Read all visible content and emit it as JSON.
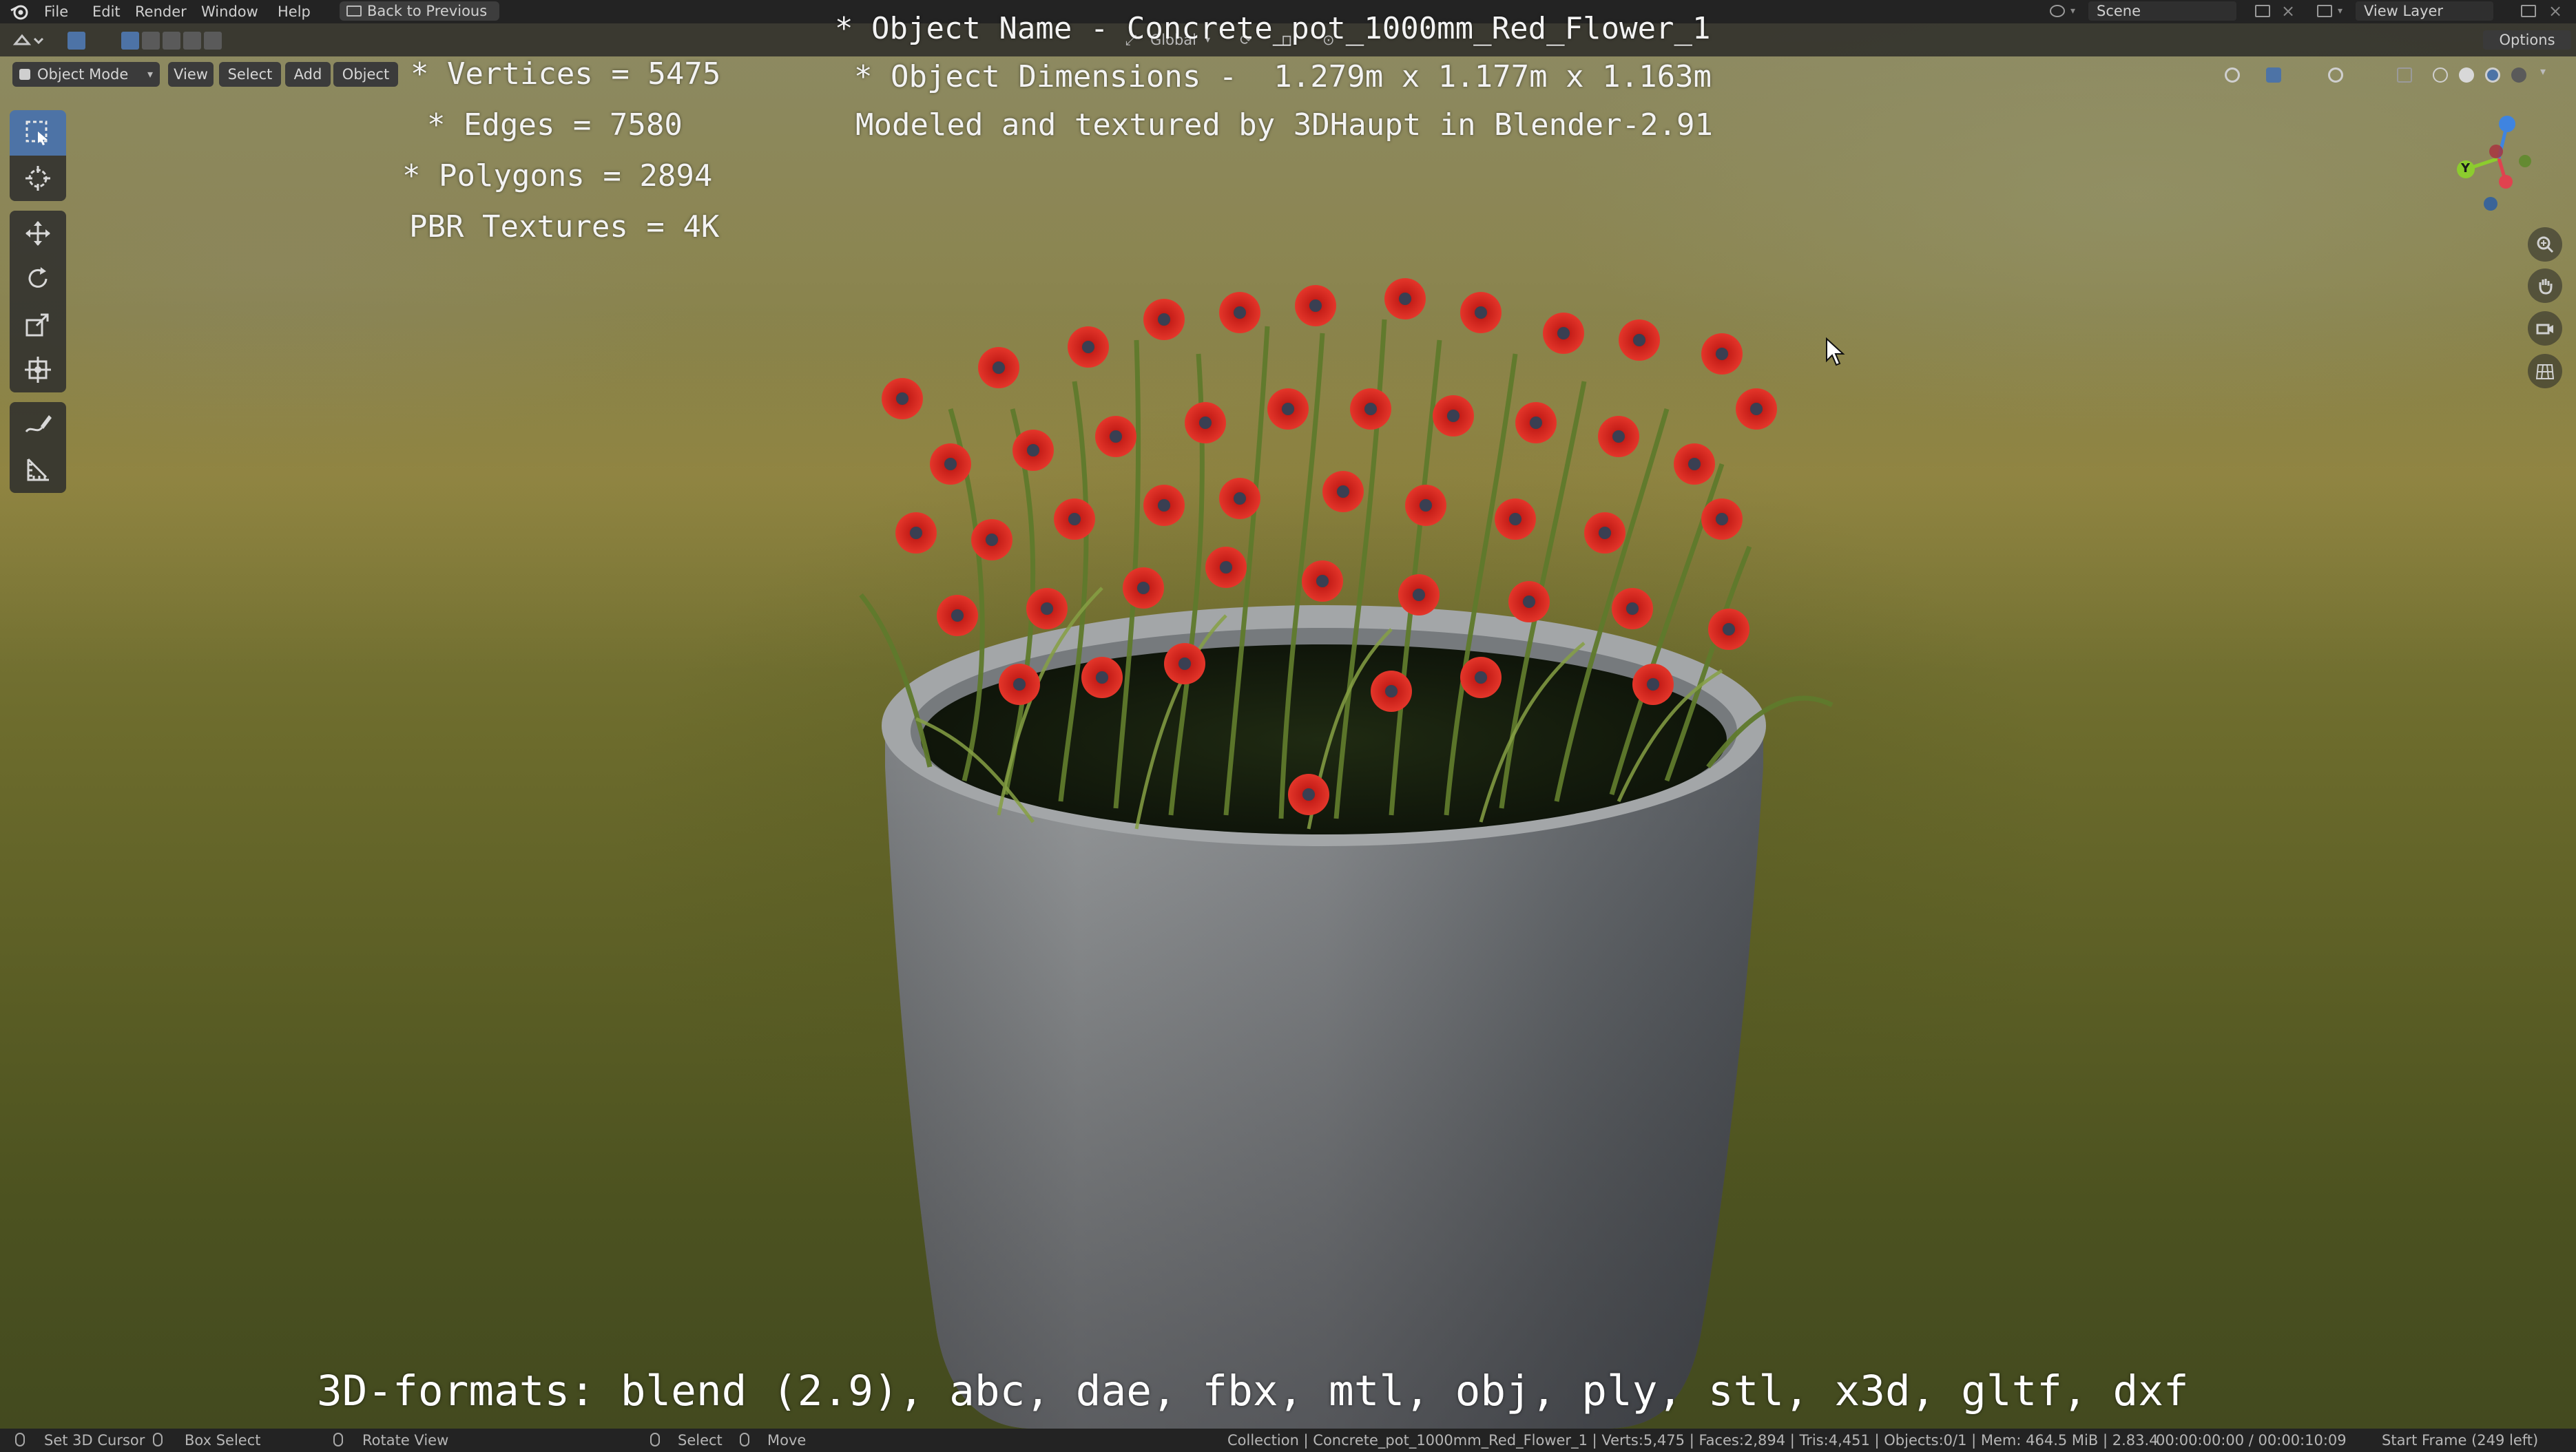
{
  "menubar": {
    "items": [
      "File",
      "Edit",
      "Render",
      "Window",
      "Help"
    ],
    "back_button": "Back to Previous",
    "scene": "Scene",
    "view_layer": "View Layer"
  },
  "viewport_header": {
    "mode": "Object Mode",
    "menus": [
      "View",
      "Select",
      "Add",
      "Object"
    ],
    "transform_orientation": "Global",
    "options": "Options"
  },
  "overlay": {
    "stats_left": [
      "* Vertices = 5475",
      "* Edges = 7580",
      "* Polygons = 2894",
      "PBR Textures = 4K"
    ],
    "info_top": [
      "* Object Name - Concrete_pot_1000mm_Red_Flower_1",
      "* Object Dimensions -  1.279m x 1.177m x 1.163m",
      "Modeled and textured by 3DHaupt in Blender-2.91"
    ],
    "formats": "3D-formats: blend (2.9), abc, dae, fbx, mtl, obj, ply, stl, x3d, gltf, dxf"
  },
  "toolbar": {
    "tools": [
      "select-box-tool",
      "cursor-tool",
      "move-tool",
      "rotate-tool",
      "scale-tool",
      "transform-tool",
      "annotate-tool",
      "measure-tool"
    ]
  },
  "nav_gizmo": {
    "axes": [
      "Y",
      "X",
      "Z"
    ]
  },
  "statusbar": {
    "hints": [
      "Set 3D Cursor",
      "Box Select",
      "Rotate View",
      "Select",
      "Move"
    ],
    "info": "Collection | Concrete_pot_1000mm_Red_Flower_1 | Verts:5,475 | Faces:2,894 | Tris:4,451 | Objects:0/1 | Mem: 464.5 MiB | 2.83.4",
    "time": "00:00:00:00 / 00:00:10:09",
    "frame": "Start Frame (249 left)"
  },
  "colors": {
    "accent": "#4d73a6",
    "flower": "#d8261f",
    "pot": "#8f9294",
    "axis_x": "#e0424f",
    "axis_y": "#8ccc2e",
    "axis_z": "#3f84e0"
  }
}
